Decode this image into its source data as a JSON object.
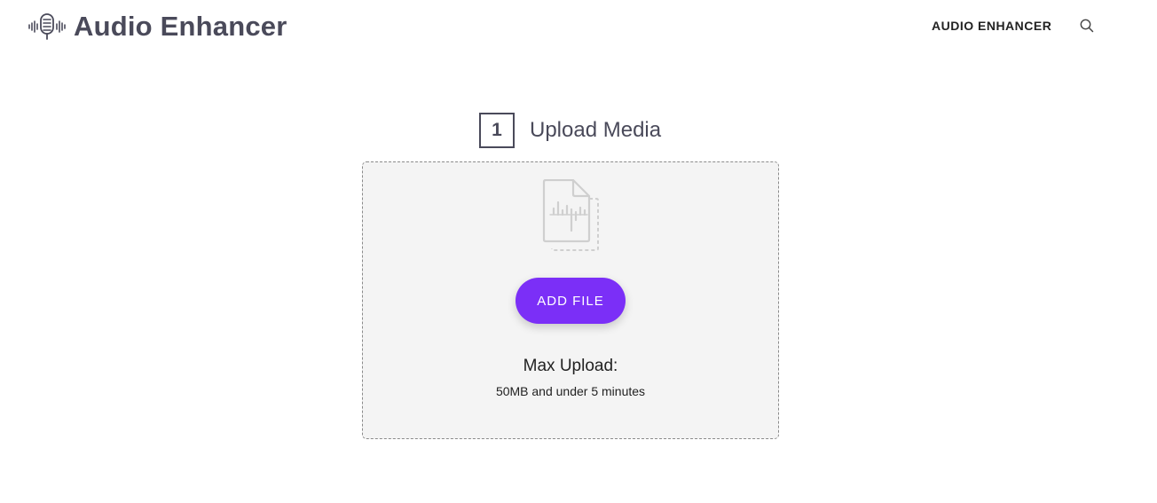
{
  "header": {
    "logo_icon": "microphone-soundwave-icon",
    "title": "Audio Enhancer",
    "nav_link": "AUDIO ENHANCER",
    "search_icon": "search-icon"
  },
  "step": {
    "number": "1",
    "title": "Upload Media"
  },
  "dropzone": {
    "file_icon": "audio-file-icon",
    "add_button_label": "ADD FILE",
    "max_upload_label": "Max Upload:",
    "max_upload_detail": "50MB and under 5 minutes"
  },
  "colors": {
    "accent": "#7b2ff7",
    "text_dark": "#4a4a5a",
    "dropzone_bg": "#f4f4f4"
  }
}
